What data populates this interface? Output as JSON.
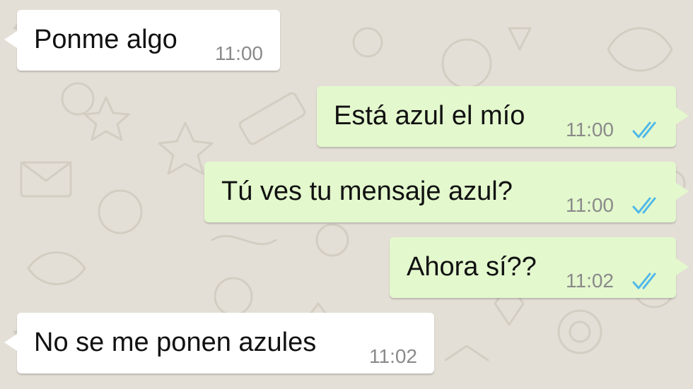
{
  "conversation": {
    "messages": [
      {
        "direction": "incoming",
        "text": "Ponme algo",
        "time": "11:00"
      },
      {
        "direction": "outgoing",
        "text": "Está azul el mío",
        "time": "11:00",
        "status": "read"
      },
      {
        "direction": "outgoing",
        "text": "Tú ves tu mensaje azul?",
        "time": "11:00",
        "status": "read"
      },
      {
        "direction": "outgoing",
        "text": "Ahora sí??",
        "time": "11:02",
        "status": "read"
      },
      {
        "direction": "incoming",
        "text": "No se me ponen azules",
        "time": "11:02"
      }
    ]
  },
  "colors": {
    "background": "#e4dfd6",
    "incoming_bubble": "#ffffff",
    "outgoing_bubble": "#e3f8cd",
    "read_ticks": "#4fb8e8",
    "time_text": "#8a8a8a"
  },
  "icons": {
    "read_status": "double-check-icon"
  }
}
